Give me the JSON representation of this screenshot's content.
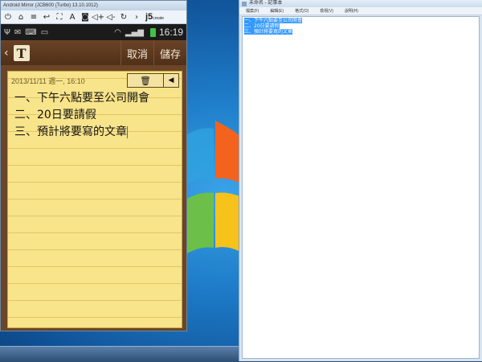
{
  "android_window": {
    "title": "Android Mirror (JCB600 (Turbo) 13.10.1012)",
    "toolbar_icons": [
      "power-icon",
      "home-icon",
      "menu-icon",
      "back-icon",
      "fullscreen-icon",
      "text-icon",
      "camera-icon",
      "volume-up-icon",
      "volume-down-icon",
      "rotate-icon",
      "forward-icon"
    ],
    "brand": "j5",
    "brand_sub": "create"
  },
  "status_bar": {
    "time": "16:19"
  },
  "memo_header": {
    "cancel_label": "取消",
    "save_label": "儲存"
  },
  "memo": {
    "date": "2013/11/11 週一, 16:10",
    "lines": [
      "一、下午六點要至公司開會",
      "二、20日要請假",
      "三、預計將要寫的文章"
    ]
  },
  "notepad": {
    "title": "未命名 - 記事本",
    "menus": [
      "檔案(F)",
      "編輯(E)",
      "格式(O)",
      "檢視(V)",
      "說明(H)"
    ],
    "lines": [
      "一、下午六點要至公司開會",
      "二、20日要請假",
      "三、預計將要寫的文章"
    ]
  }
}
